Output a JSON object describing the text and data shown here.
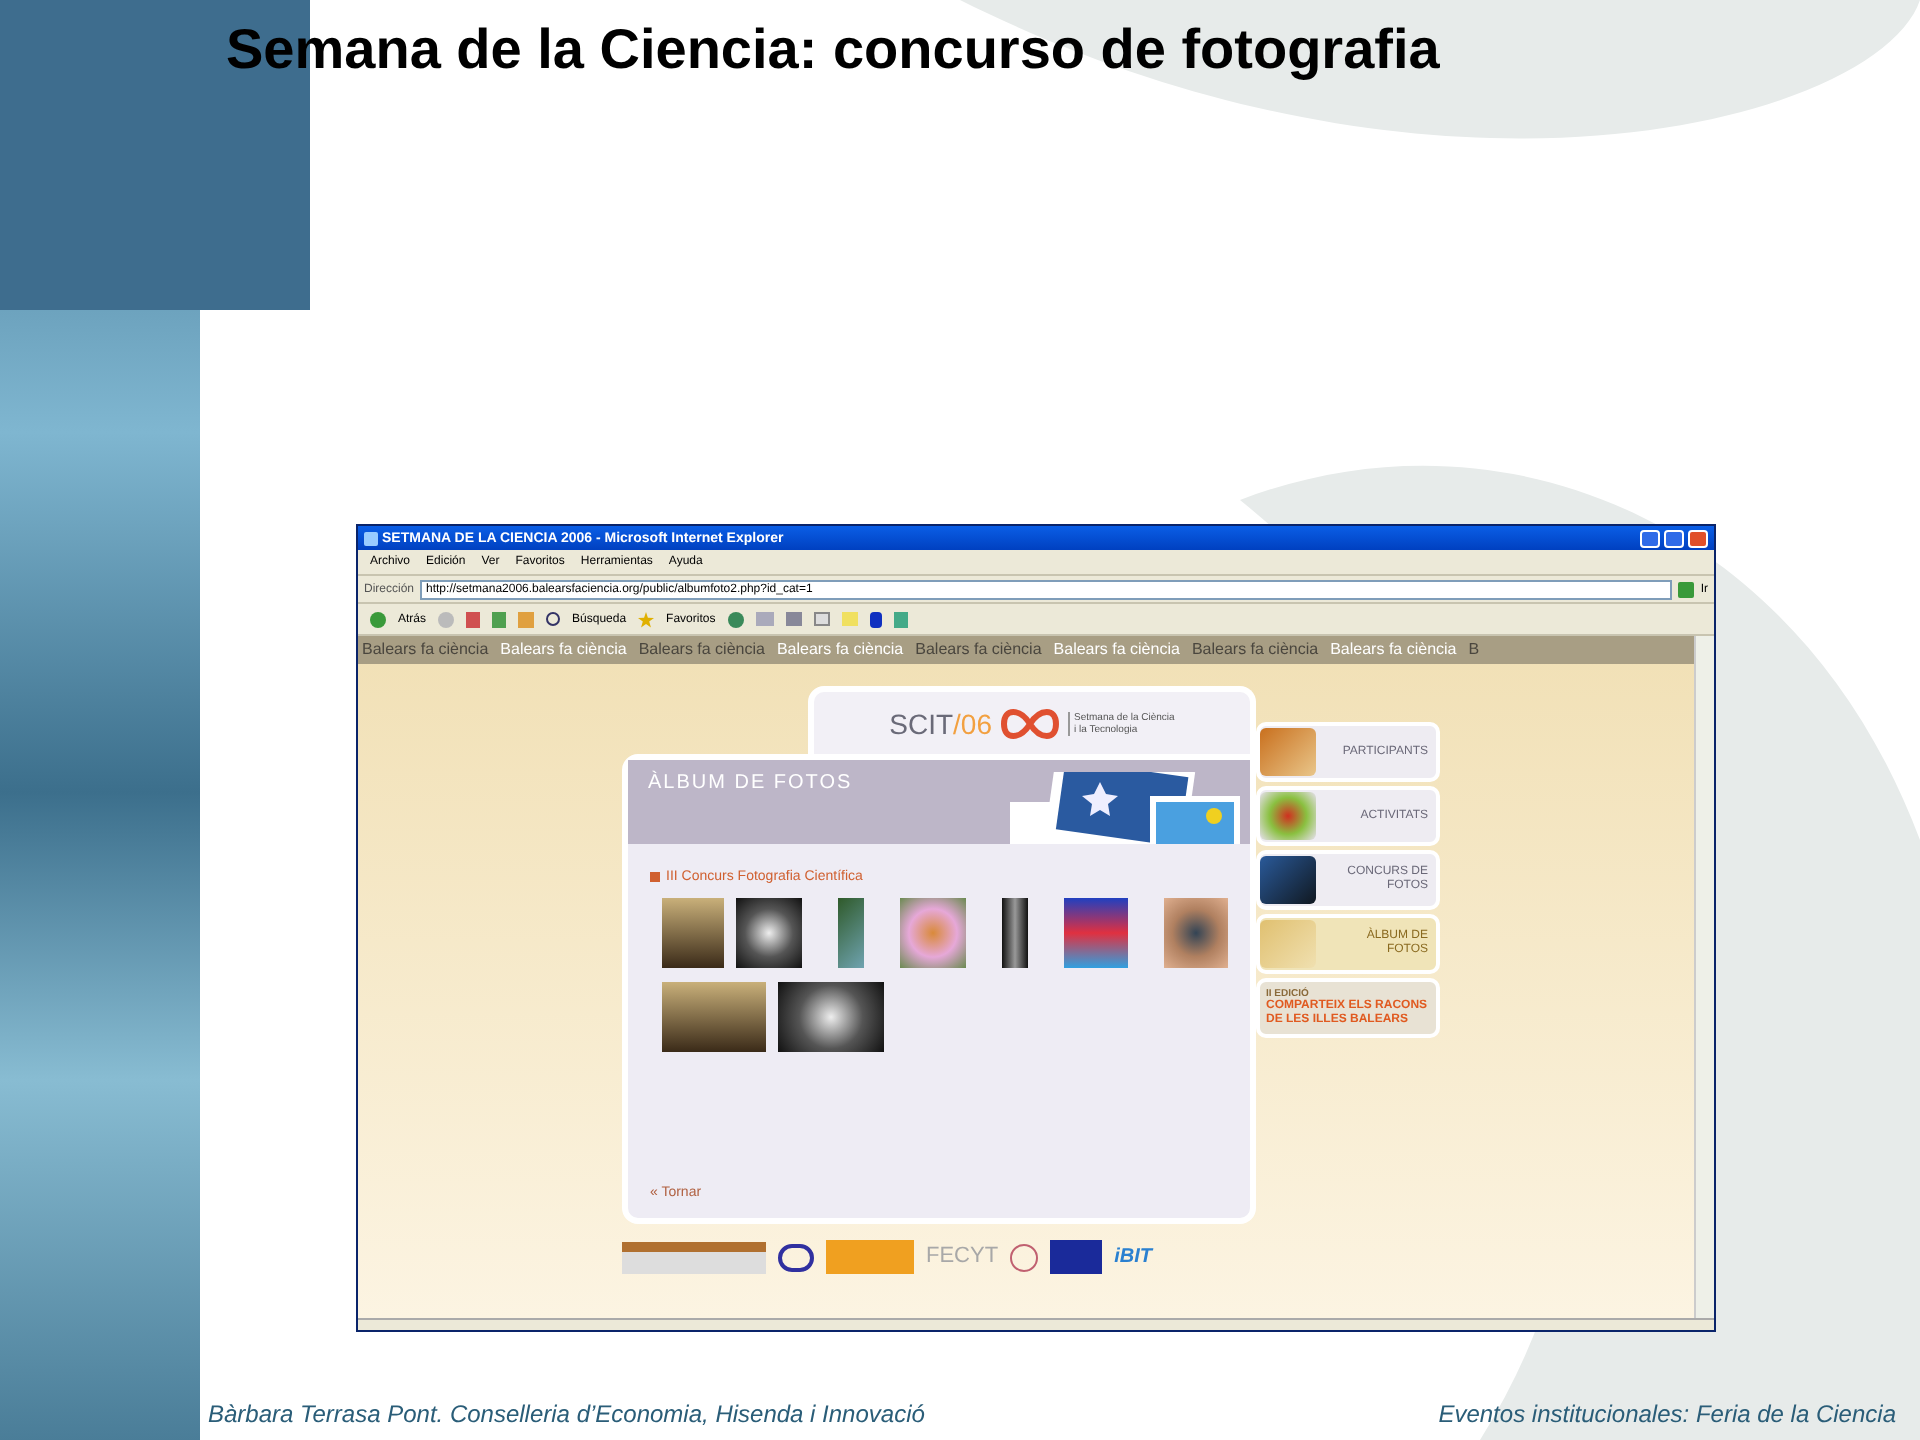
{
  "slide": {
    "title": "Semana de la Ciencia: concurso de fotografia",
    "footer_left": "Bàrbara Terrasa Pont. Conselleria d’Economia, Hisenda i Innovació",
    "footer_right": "Eventos institucionales: Feria de la Ciencia"
  },
  "browser": {
    "title": "SETMANA DE LA CIENCIA 2006 - Microsoft Internet Explorer",
    "menu": [
      "Archivo",
      "Edición",
      "Ver",
      "Favoritos",
      "Herramientas",
      "Ayuda"
    ],
    "address_label": "Dirección",
    "url": "http://setmana2006.balearsfaciencia.org/public/albumfoto2.php?id_cat=1",
    "go": "Ir",
    "toolbar": {
      "back": "Atrás",
      "search": "Búsqueda",
      "favorites": "Favoritos"
    }
  },
  "page": {
    "banner": [
      "Balears fa ciència",
      "Balears fa ciència",
      "Balears fa ciència",
      "Balears fa ciència",
      "Balears fa ciència",
      "Balears fa ciència",
      "Balears fa ciència",
      "Balears fa ciència",
      "B"
    ],
    "logo": {
      "name": "SCIT",
      "year": "/06",
      "caption_line_1": "Setmana de la Ciència",
      "caption_line_2": "i la Tecnologia"
    },
    "header": "ÀLBUM DE FOTOS",
    "section": "III Concurs Fotografia Científica",
    "back_link": "« Tornar",
    "nav": [
      {
        "kind": "tab",
        "label": "PARTICIPANTS",
        "selected": false
      },
      {
        "kind": "tab",
        "label": "ACTIVITATS",
        "selected": false
      },
      {
        "kind": "tab",
        "label": "CONCURS DE FOTOS",
        "selected": false
      },
      {
        "kind": "tab",
        "label": "ÀLBUM DE FOTOS",
        "selected": true
      },
      {
        "kind": "promo",
        "edition": "II EDICIÓ",
        "title": "COMPARTEIX ELS RACONS DE LES ILLES BALEARS"
      }
    ],
    "sponsors": {
      "fecyt": "FECYT",
      "ibit": "iBIT"
    }
  }
}
